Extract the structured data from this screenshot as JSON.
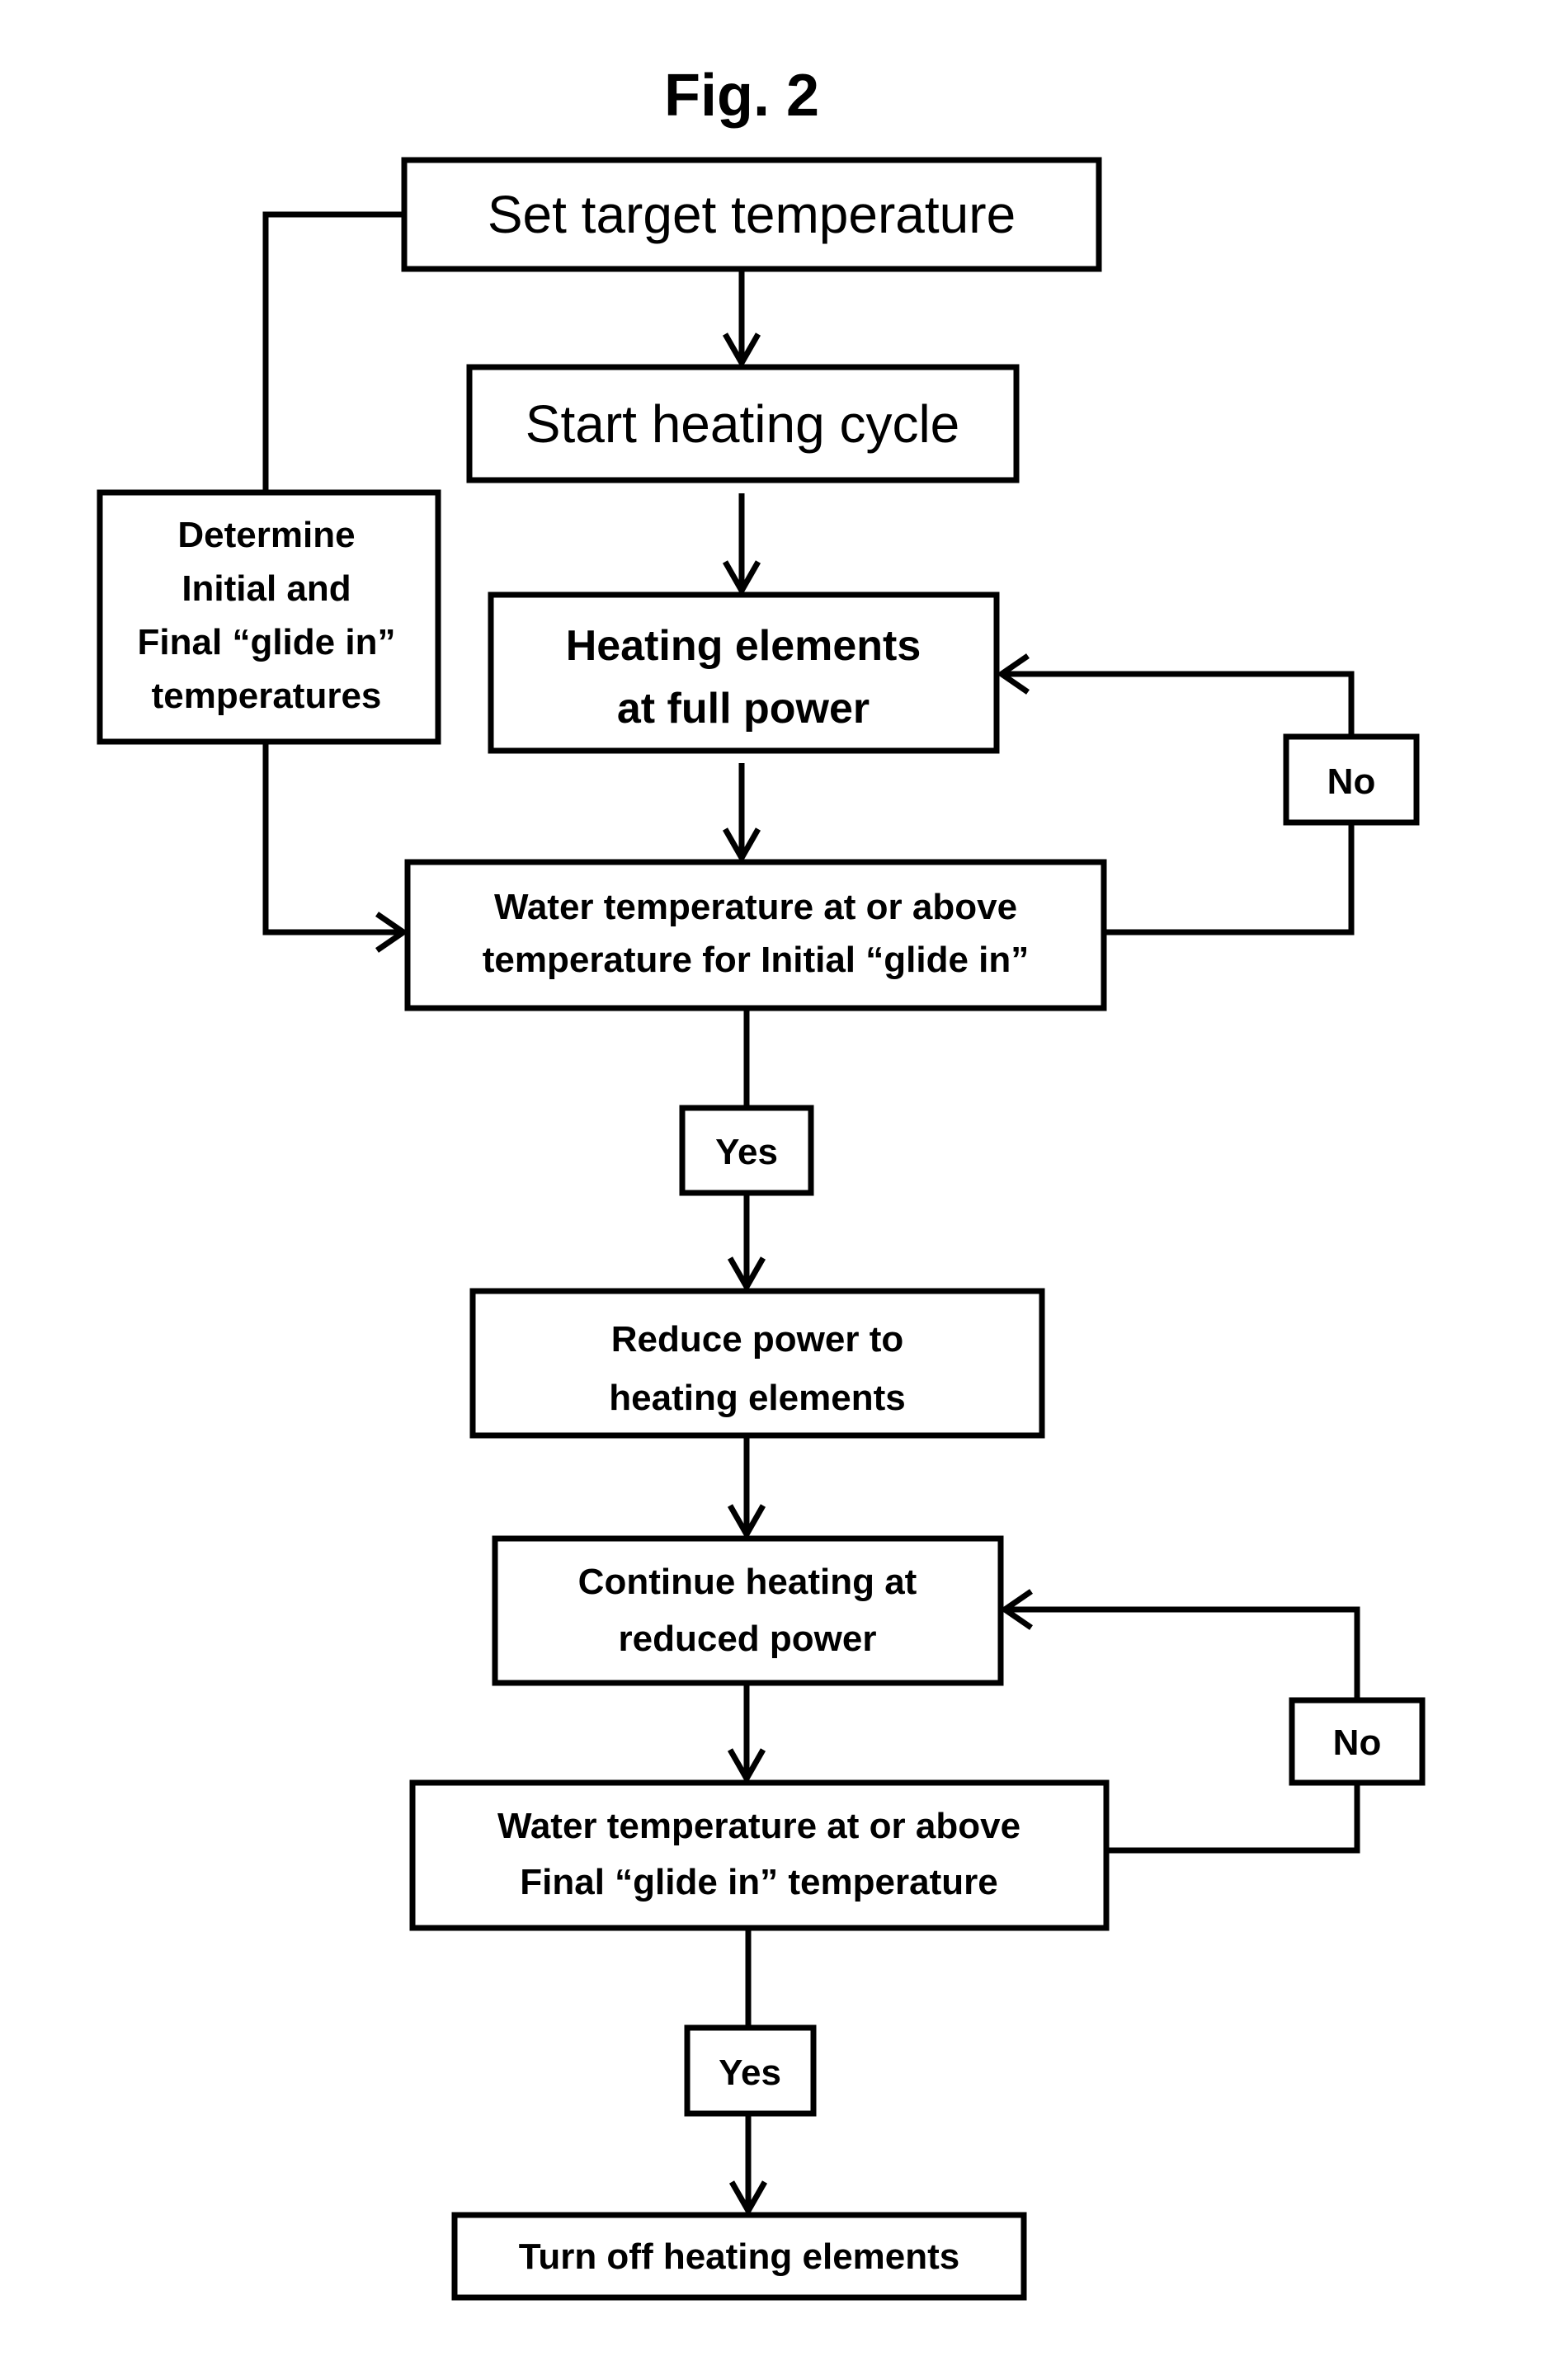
{
  "title": "Fig. 2",
  "nodes": {
    "set_target": {
      "lines": [
        "Set target temperature"
      ]
    },
    "start_cycle": {
      "lines": [
        "Start heating cycle"
      ]
    },
    "full_power": {
      "lines": [
        "Heating elements",
        "at full power"
      ]
    },
    "determine": {
      "lines": [
        "Determine",
        "Initial and",
        "Final “glide in”",
        "temperatures"
      ]
    },
    "check_initial": {
      "lines": [
        "Water temperature at or above",
        "temperature for Initial “glide in”"
      ]
    },
    "reduce_power": {
      "lines": [
        "Reduce power to",
        "heating elements"
      ]
    },
    "continue_reduced": {
      "lines": [
        "Continue heating at",
        "reduced power"
      ]
    },
    "check_final": {
      "lines": [
        "Water temperature at or above",
        "Final “glide in” temperature"
      ]
    },
    "turn_off": {
      "lines": [
        "Turn off heating elements"
      ]
    }
  },
  "labels": {
    "no_1": "No",
    "yes_1": "Yes",
    "no_2": "No",
    "yes_2": "Yes"
  },
  "colors": {
    "stroke": "#000000",
    "background": "#ffffff"
  }
}
